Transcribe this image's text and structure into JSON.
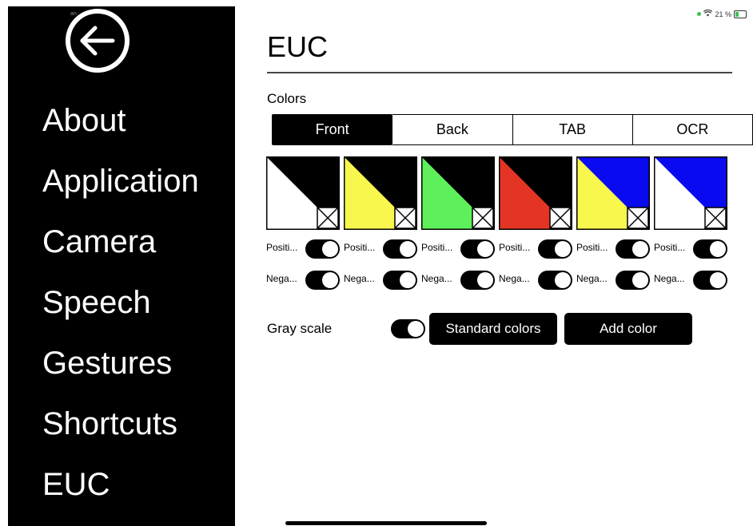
{
  "status": {
    "left": "an",
    "battery_text": "21 %",
    "dot_color": "#3cc14e"
  },
  "sidebar": {
    "items": [
      {
        "label": "About"
      },
      {
        "label": "Application"
      },
      {
        "label": "Camera"
      },
      {
        "label": "Speech"
      },
      {
        "label": "Gestures"
      },
      {
        "label": "Shortcuts"
      },
      {
        "label": "EUC"
      }
    ]
  },
  "main": {
    "title": "EUC",
    "colors_label": "Colors",
    "tabs": [
      {
        "label": "Front",
        "active": true
      },
      {
        "label": "Back",
        "active": false
      },
      {
        "label": "TAB",
        "active": false
      },
      {
        "label": "OCR",
        "active": false
      }
    ],
    "swatches": [
      {
        "bottom_color": "#ffffff",
        "top_color": "#000000",
        "positive_label": "Positi...",
        "negative_label": "Nega...",
        "positive_on": true,
        "negative_on": true
      },
      {
        "bottom_color": "#f7f74d",
        "top_color": "#000000",
        "positive_label": "Positi...",
        "negative_label": "Nega...",
        "positive_on": true,
        "negative_on": true
      },
      {
        "bottom_color": "#5ef05a",
        "top_color": "#000000",
        "positive_label": "Positi...",
        "negative_label": "Nega...",
        "positive_on": true,
        "negative_on": true
      },
      {
        "bottom_color": "#e33425",
        "top_color": "#000000",
        "positive_label": "Positi...",
        "negative_label": "Nega...",
        "positive_on": true,
        "negative_on": true
      },
      {
        "bottom_color": "#f7f74d",
        "top_color": "#0a0af0",
        "positive_label": "Positi...",
        "negative_label": "Nega...",
        "positive_on": true,
        "negative_on": true
      },
      {
        "bottom_color": "#ffffff",
        "top_color": "#0a0af0",
        "positive_label": "Positi...",
        "negative_label": "Nega...",
        "positive_on": true,
        "negative_on": true
      }
    ],
    "gray_scale_label": "Gray scale",
    "gray_scale_on": true,
    "standard_colors_label": "Standard colors",
    "add_color_label": "Add color"
  }
}
